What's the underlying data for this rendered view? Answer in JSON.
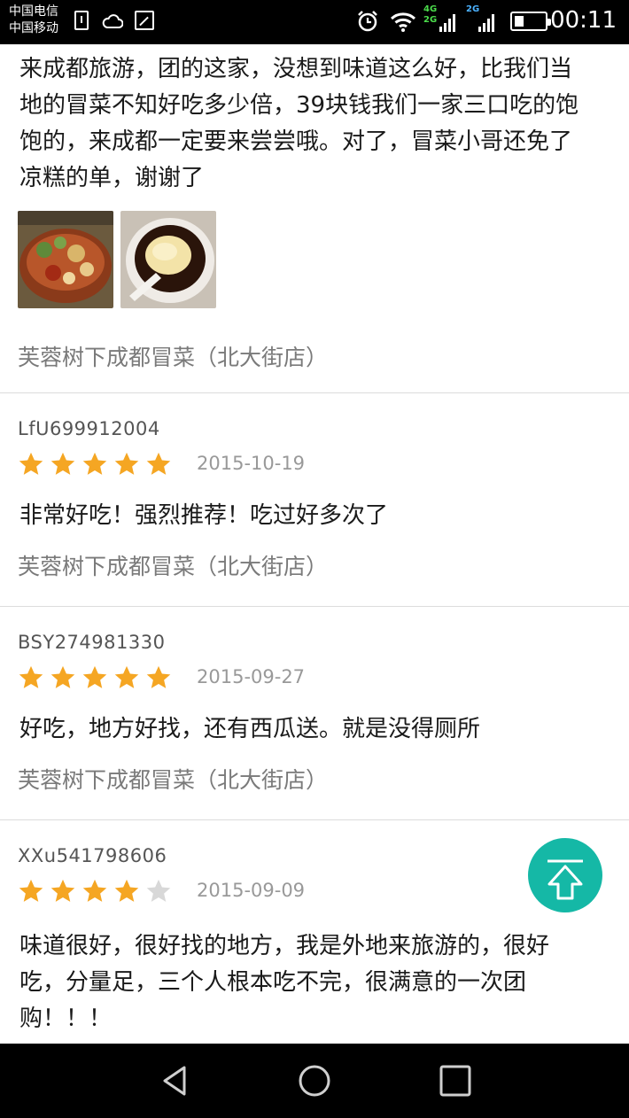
{
  "status_bar": {
    "carrier_1": "中国电信",
    "carrier_2": "中国移动",
    "network_1": "4G",
    "network_1b": "2G",
    "network_2": "2G",
    "time": "00:11",
    "icons": [
      "sim-icon",
      "cloud-icon",
      "image-icon",
      "alarm-icon",
      "wifi-icon",
      "signal-icon",
      "battery-icon"
    ]
  },
  "reviews": [
    {
      "text": "来成都旅游，团的这家，没想到味道这么好，比我们当地的冒菜不知好吃多少倍，39块钱我们一家三口吃的饱饱的，来成都一定要来尝尝哦。对了，冒菜小哥还免了凉糕的单，谢谢了",
      "photos": [
        "food-photo-maocai",
        "food-photo-lianggao"
      ],
      "shop": "芙蓉树下成都冒菜（北大街店）"
    },
    {
      "user": "LfU699912004",
      "rating": 5,
      "date": "2015-10-19",
      "text": "非常好吃！强烈推荐！吃过好多次了",
      "shop": "芙蓉树下成都冒菜（北大街店）"
    },
    {
      "user": "BSY274981330",
      "rating": 5,
      "date": "2015-09-27",
      "text": "好吃，地方好找，还有西瓜送。就是没得厕所",
      "shop": "芙蓉树下成都冒菜（北大街店）"
    },
    {
      "user": "XXu541798606",
      "rating": 4,
      "date": "2015-09-09",
      "text": "味道很好，很好找的地方，我是外地来旅游的，很好吃，分量足，三个人根本吃不完，很满意的一次团购！！！"
    }
  ],
  "colors": {
    "star_filled": "#f5a623",
    "star_empty": "#d8d8d8",
    "to_top_button": "#15b8a6"
  },
  "floating": {
    "to_top_icon": "arrow-up-icon"
  },
  "nav_bar": {
    "icons": [
      "back-triangle-icon",
      "home-circle-icon",
      "recents-square-icon"
    ]
  }
}
